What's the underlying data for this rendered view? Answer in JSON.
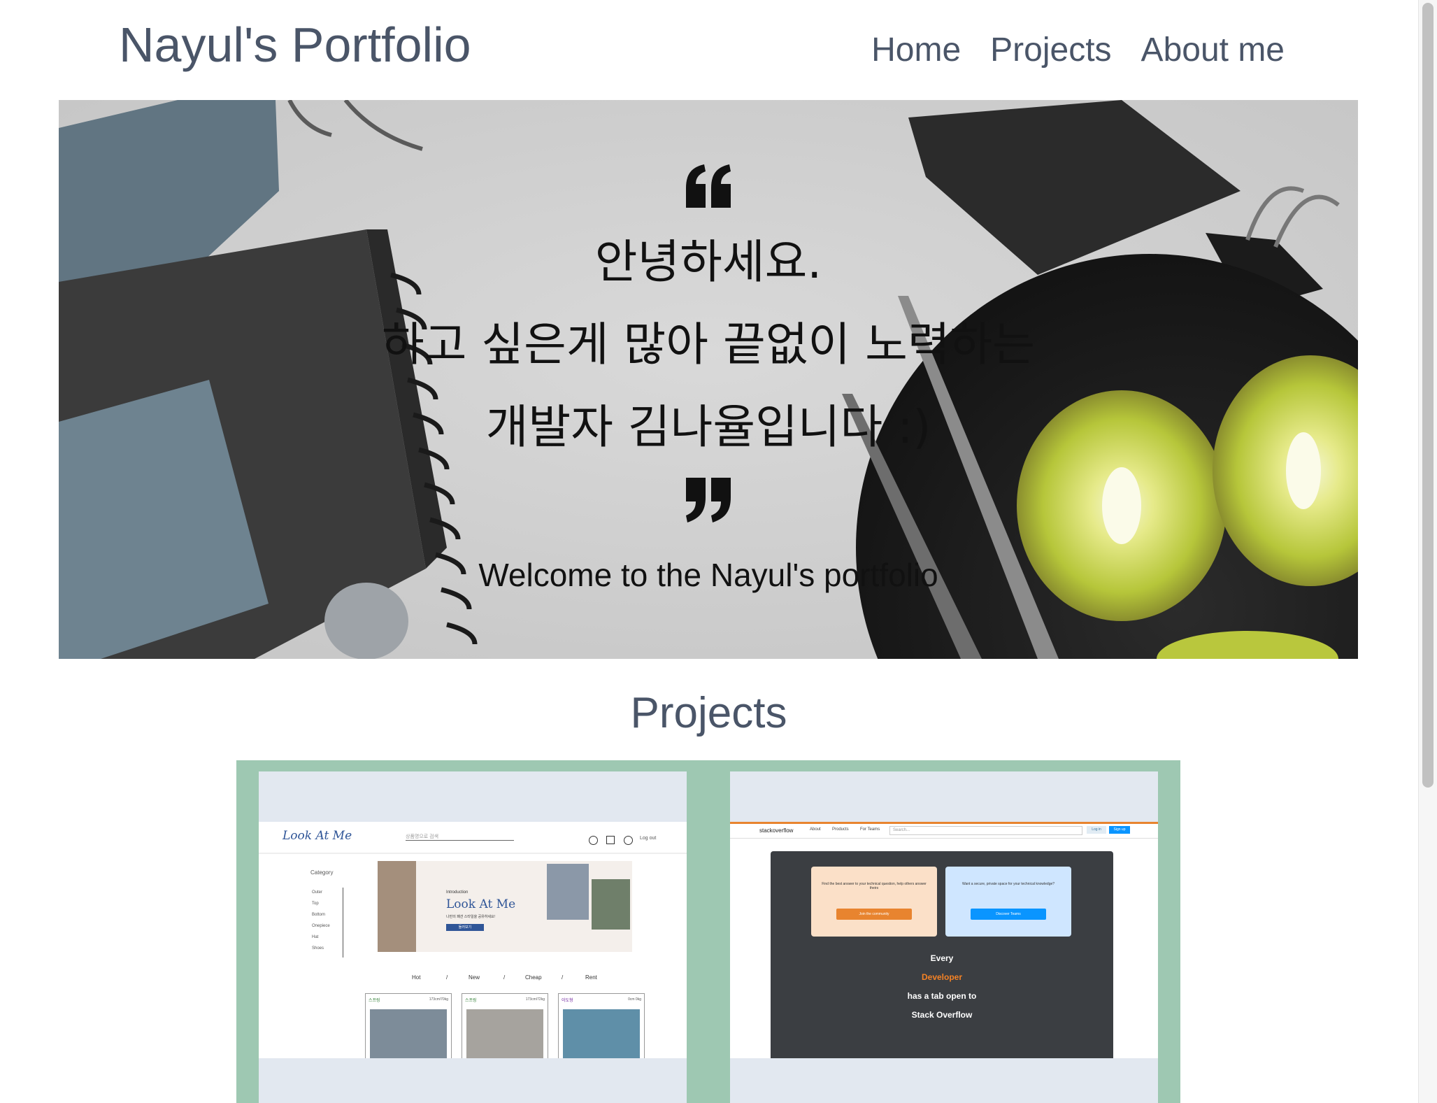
{
  "header": {
    "brand": "Nayul's Portfolio",
    "nav": [
      "Home",
      "Projects",
      "About me"
    ]
  },
  "hero": {
    "open_quote_icon": "quote-open-icon",
    "lines": [
      "안녕하세요.",
      "하고 싶은게 많아 끝없이 노력하는",
      "개발자 김나율입니다 :)"
    ],
    "close_quote_icon": "quote-close-icon",
    "welcome": "Welcome to the Nayul's portfolio"
  },
  "projects": {
    "title": "Projects",
    "cards": [
      {
        "name": "Look At Me",
        "logo": "Look At Me",
        "search_placeholder": "상품명으로 검색",
        "logout": "Log out",
        "category_title": "Category",
        "categories": [
          "Outer",
          "Top",
          "Bottom",
          "Onepiece",
          "Hat",
          "Shoes"
        ],
        "intro_label": "Introduction",
        "intro_title": "Look At Me",
        "intro_text": "나만의 패션 스타일을 공유하세요!",
        "intro_button": "둘러보기",
        "tabs": [
          "Hot",
          "/",
          "New",
          "/",
          "Cheap",
          "/",
          "Rent"
        ],
        "posts": [
          {
            "user": "스프링",
            "size": "173cm/70kg"
          },
          {
            "user": "스프링",
            "size": "173cm/72kg"
          },
          {
            "user": "이도형",
            "size": "0cm 0kg"
          }
        ]
      },
      {
        "name": "Stack Overflow",
        "logo": "stackoverflow",
        "nav": [
          "About",
          "Products",
          "For Teams"
        ],
        "search_placeholder": "Search...",
        "login": "Log in",
        "signup": "Sign up",
        "box1_text": "Find the best answer to your technical question, help others answer theirs",
        "box1_button": "Join the community",
        "box2_text": "Want a secure, private space for your technical knowledge?",
        "box2_button": "Discover Teams",
        "tagline": [
          "Every",
          "Developer",
          "has a tab open to",
          "Stack Overflow"
        ]
      }
    ]
  },
  "colors": {
    "text": "#4a5568",
    "panel": "#9ec8b2",
    "card_bg": "#e2e8f0",
    "so_orange": "#e8842f",
    "so_blue": "#0a95ff",
    "so_dark": "#3b3e42"
  }
}
